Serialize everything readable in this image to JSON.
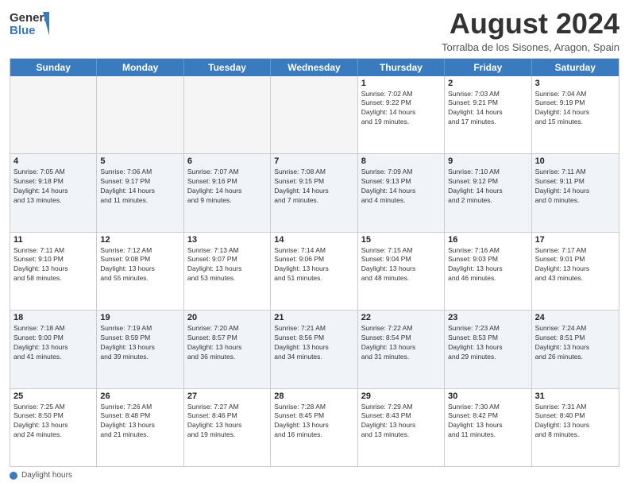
{
  "header": {
    "logo_line1": "General",
    "logo_line2": "Blue",
    "month_year": "August 2024",
    "location": "Torralba de los Sisones, Aragon, Spain"
  },
  "days_of_week": [
    "Sunday",
    "Monday",
    "Tuesday",
    "Wednesday",
    "Thursday",
    "Friday",
    "Saturday"
  ],
  "footer": {
    "label": "Daylight hours"
  },
  "weeks": [
    {
      "cells": [
        {
          "day": "",
          "content": ""
        },
        {
          "day": "",
          "content": ""
        },
        {
          "day": "",
          "content": ""
        },
        {
          "day": "",
          "content": ""
        },
        {
          "day": "1",
          "content": "Sunrise: 7:02 AM\nSunset: 9:22 PM\nDaylight: 14 hours\nand 19 minutes."
        },
        {
          "day": "2",
          "content": "Sunrise: 7:03 AM\nSunset: 9:21 PM\nDaylight: 14 hours\nand 17 minutes."
        },
        {
          "day": "3",
          "content": "Sunrise: 7:04 AM\nSunset: 9:19 PM\nDaylight: 14 hours\nand 15 minutes."
        }
      ]
    },
    {
      "cells": [
        {
          "day": "4",
          "content": "Sunrise: 7:05 AM\nSunset: 9:18 PM\nDaylight: 14 hours\nand 13 minutes."
        },
        {
          "day": "5",
          "content": "Sunrise: 7:06 AM\nSunset: 9:17 PM\nDaylight: 14 hours\nand 11 minutes."
        },
        {
          "day": "6",
          "content": "Sunrise: 7:07 AM\nSunset: 9:16 PM\nDaylight: 14 hours\nand 9 minutes."
        },
        {
          "day": "7",
          "content": "Sunrise: 7:08 AM\nSunset: 9:15 PM\nDaylight: 14 hours\nand 7 minutes."
        },
        {
          "day": "8",
          "content": "Sunrise: 7:09 AM\nSunset: 9:13 PM\nDaylight: 14 hours\nand 4 minutes."
        },
        {
          "day": "9",
          "content": "Sunrise: 7:10 AM\nSunset: 9:12 PM\nDaylight: 14 hours\nand 2 minutes."
        },
        {
          "day": "10",
          "content": "Sunrise: 7:11 AM\nSunset: 9:11 PM\nDaylight: 14 hours\nand 0 minutes."
        }
      ]
    },
    {
      "cells": [
        {
          "day": "11",
          "content": "Sunrise: 7:11 AM\nSunset: 9:10 PM\nDaylight: 13 hours\nand 58 minutes."
        },
        {
          "day": "12",
          "content": "Sunrise: 7:12 AM\nSunset: 9:08 PM\nDaylight: 13 hours\nand 55 minutes."
        },
        {
          "day": "13",
          "content": "Sunrise: 7:13 AM\nSunset: 9:07 PM\nDaylight: 13 hours\nand 53 minutes."
        },
        {
          "day": "14",
          "content": "Sunrise: 7:14 AM\nSunset: 9:06 PM\nDaylight: 13 hours\nand 51 minutes."
        },
        {
          "day": "15",
          "content": "Sunrise: 7:15 AM\nSunset: 9:04 PM\nDaylight: 13 hours\nand 48 minutes."
        },
        {
          "day": "16",
          "content": "Sunrise: 7:16 AM\nSunset: 9:03 PM\nDaylight: 13 hours\nand 46 minutes."
        },
        {
          "day": "17",
          "content": "Sunrise: 7:17 AM\nSunset: 9:01 PM\nDaylight: 13 hours\nand 43 minutes."
        }
      ]
    },
    {
      "cells": [
        {
          "day": "18",
          "content": "Sunrise: 7:18 AM\nSunset: 9:00 PM\nDaylight: 13 hours\nand 41 minutes."
        },
        {
          "day": "19",
          "content": "Sunrise: 7:19 AM\nSunset: 8:59 PM\nDaylight: 13 hours\nand 39 minutes."
        },
        {
          "day": "20",
          "content": "Sunrise: 7:20 AM\nSunset: 8:57 PM\nDaylight: 13 hours\nand 36 minutes."
        },
        {
          "day": "21",
          "content": "Sunrise: 7:21 AM\nSunset: 8:56 PM\nDaylight: 13 hours\nand 34 minutes."
        },
        {
          "day": "22",
          "content": "Sunrise: 7:22 AM\nSunset: 8:54 PM\nDaylight: 13 hours\nand 31 minutes."
        },
        {
          "day": "23",
          "content": "Sunrise: 7:23 AM\nSunset: 8:53 PM\nDaylight: 13 hours\nand 29 minutes."
        },
        {
          "day": "24",
          "content": "Sunrise: 7:24 AM\nSunset: 8:51 PM\nDaylight: 13 hours\nand 26 minutes."
        }
      ]
    },
    {
      "cells": [
        {
          "day": "25",
          "content": "Sunrise: 7:25 AM\nSunset: 8:50 PM\nDaylight: 13 hours\nand 24 minutes."
        },
        {
          "day": "26",
          "content": "Sunrise: 7:26 AM\nSunset: 8:48 PM\nDaylight: 13 hours\nand 21 minutes."
        },
        {
          "day": "27",
          "content": "Sunrise: 7:27 AM\nSunset: 8:46 PM\nDaylight: 13 hours\nand 19 minutes."
        },
        {
          "day": "28",
          "content": "Sunrise: 7:28 AM\nSunset: 8:45 PM\nDaylight: 13 hours\nand 16 minutes."
        },
        {
          "day": "29",
          "content": "Sunrise: 7:29 AM\nSunset: 8:43 PM\nDaylight: 13 hours\nand 13 minutes."
        },
        {
          "day": "30",
          "content": "Sunrise: 7:30 AM\nSunset: 8:42 PM\nDaylight: 13 hours\nand 11 minutes."
        },
        {
          "day": "31",
          "content": "Sunrise: 7:31 AM\nSunset: 8:40 PM\nDaylight: 13 hours\nand 8 minutes."
        }
      ]
    }
  ]
}
